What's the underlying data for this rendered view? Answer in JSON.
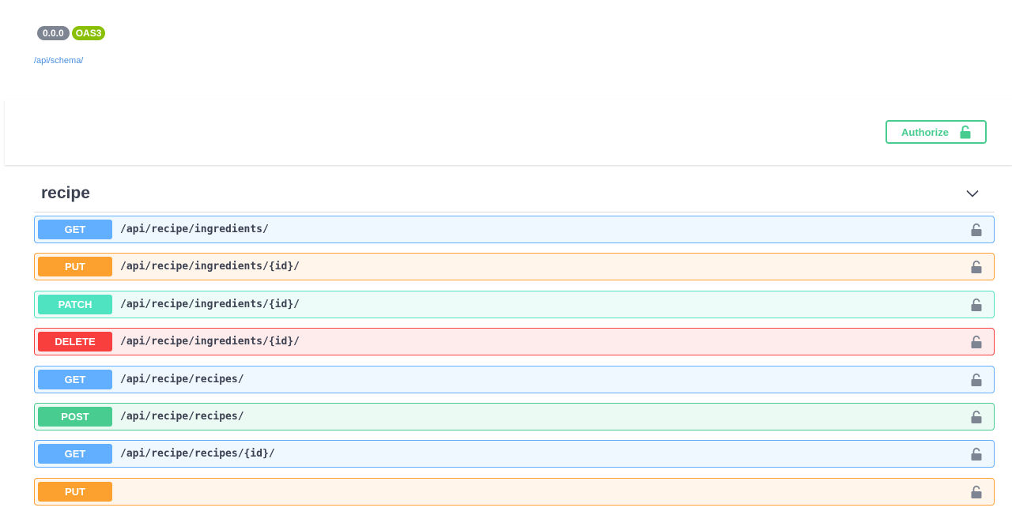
{
  "info": {
    "version_badge": "0.0.0",
    "oas_badge": "OAS3",
    "schema_link": "/api/schema/"
  },
  "auth": {
    "authorize_label": "Authorize",
    "icon": "unlock-icon"
  },
  "tag": {
    "title": "recipe",
    "expanded": true
  },
  "operations": [
    {
      "method": "GET",
      "path": "/api/recipe/ingredients/"
    },
    {
      "method": "PUT",
      "path": "/api/recipe/ingredients/{id}/"
    },
    {
      "method": "PATCH",
      "path": "/api/recipe/ingredients/{id}/"
    },
    {
      "method": "DELETE",
      "path": "/api/recipe/ingredients/{id}/"
    },
    {
      "method": "GET",
      "path": "/api/recipe/recipes/"
    },
    {
      "method": "POST",
      "path": "/api/recipe/recipes/"
    },
    {
      "method": "GET",
      "path": "/api/recipe/recipes/{id}/"
    },
    {
      "method": "PUT",
      "path": ""
    }
  ],
  "colors": {
    "get": "#61affe",
    "put": "#fca130",
    "patch": "#50e3c2",
    "delete": "#f93e3e",
    "post": "#49cc90",
    "link": "#4990e2",
    "version_badge": "#7d8492",
    "oas_badge": "#89bf04"
  }
}
